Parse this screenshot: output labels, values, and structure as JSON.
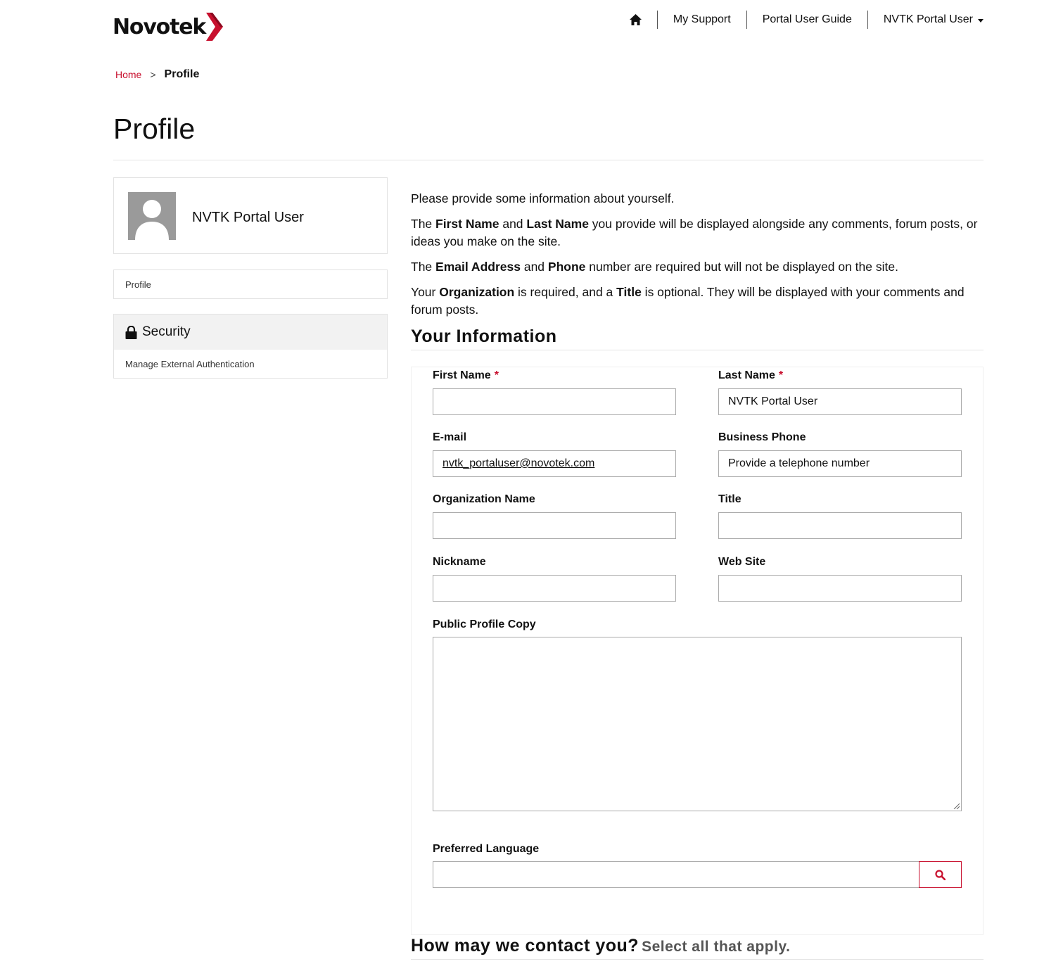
{
  "brand": {
    "name": "Novotek",
    "accent": "#c8102e"
  },
  "nav": {
    "home_icon": "home-icon",
    "items": [
      "My Support",
      "Portal User Guide"
    ],
    "user_menu": "NVTK Portal User"
  },
  "breadcrumb": {
    "home": "Home",
    "separator": ">",
    "current": "Profile"
  },
  "page": {
    "title": "Profile"
  },
  "sidebar": {
    "user_name": "NVTK Portal User",
    "profile_link": "Profile",
    "security_heading": "Security",
    "security_link": "Manage External Authentication"
  },
  "intro": {
    "p1": "Please provide some information about yourself.",
    "p2": {
      "a": "The ",
      "b1": "First Name",
      "c": " and ",
      "b2": "Last Name",
      "d": " you provide will be displayed alongside any comments, forum posts, or ideas you make on the site."
    },
    "p3": {
      "a": "The ",
      "b1": "Email Address",
      "c": " and ",
      "b2": "Phone",
      "d": " number are required but will not be displayed on the site."
    },
    "p4": {
      "a": "Your ",
      "b1": "Organization",
      "c": " is required, and a ",
      "b2": "Title",
      "d": " is optional. They will be displayed with your comments and forum posts."
    }
  },
  "form": {
    "section_title": "Your Information",
    "required_marker": "*",
    "first_name": {
      "label": "First Name",
      "value": ""
    },
    "last_name": {
      "label": "Last Name",
      "value": "NVTK Portal User"
    },
    "email": {
      "label": "E-mail",
      "value": "nvtk_portaluser@novotek.com"
    },
    "business_phone": {
      "label": "Business Phone",
      "placeholder": "Provide a telephone number"
    },
    "organization": {
      "label": "Organization Name",
      "value": ""
    },
    "title": {
      "label": "Title",
      "value": ""
    },
    "nickname": {
      "label": "Nickname",
      "value": ""
    },
    "website": {
      "label": "Web Site",
      "value": ""
    },
    "public_profile": {
      "label": "Public Profile Copy",
      "value": ""
    },
    "preferred_language": {
      "label": "Preferred Language",
      "value": ""
    }
  },
  "contact": {
    "title": "How may we contact you?",
    "subtitle": "Select all that apply."
  }
}
